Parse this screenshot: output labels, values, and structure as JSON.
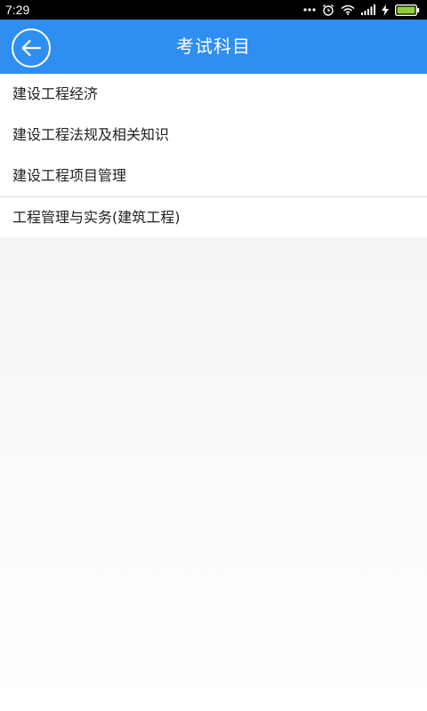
{
  "status_bar": {
    "time": "7:29",
    "icons": [
      "more-dots-icon",
      "alarm-icon",
      "wifi-icon",
      "signal-icon",
      "charging-bolt-icon",
      "battery-icon"
    ]
  },
  "app_bar": {
    "title": "考试科目",
    "back_icon": "back-arrow-icon",
    "background_color": "#2f8ef2"
  },
  "subjects": [
    {
      "label": "建设工程经济"
    },
    {
      "label": "建设工程法规及相关知识"
    },
    {
      "label": "建设工程项目管理"
    },
    {
      "label": "工程管理与实务(建筑工程)"
    }
  ]
}
